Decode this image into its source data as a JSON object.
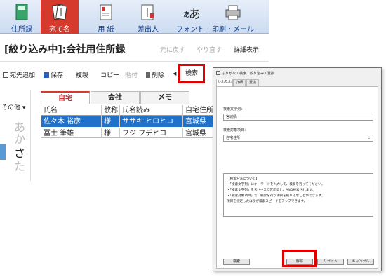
{
  "ribbon": {
    "tabs": [
      {
        "label": "住所録",
        "icon": "address-book-icon"
      },
      {
        "label": "宛て名",
        "icon": "envelope-address-icon",
        "active": true
      },
      {
        "label": "用 紙",
        "icon": "paper-icon"
      },
      {
        "label": "差出人",
        "icon": "sender-icon"
      },
      {
        "label": "フォント",
        "icon": "font-icon"
      },
      {
        "label": "印刷・メール",
        "icon": "printer-mail-icon"
      }
    ],
    "active_color": "#d53a2c",
    "label_color": "#0f3f8c"
  },
  "titlebar": {
    "title": "[絞り込み中]:会社用住所録",
    "undo_label": "元に戻す",
    "redo_label": "やり直す",
    "detail_label": "詳細表示"
  },
  "toolbar": {
    "add_label": "宛先追加",
    "save_label": "保存",
    "duplicate_label": "複製",
    "copy_label": "コピー",
    "paste_label": "貼付",
    "delete_label": "削除",
    "search_label": "検索"
  },
  "left_panel": {
    "group_label": "その他",
    "kana": [
      "あ",
      "か",
      "さ",
      "た"
    ],
    "selected_kana": "さ"
  },
  "grid_tabs": [
    "自宅",
    "会社",
    "メモ"
  ],
  "table": {
    "columns": [
      "氏名",
      "敬称",
      "氏名読み",
      "自宅住所"
    ],
    "rows": [
      {
        "name": "佐々木 裕彦",
        "honorific": "様",
        "reading": "ササキ ヒロヒコ",
        "address": "宮城県"
      },
      {
        "name": "冨士 筆雄",
        "honorific": "様",
        "reading": "フジ フデヒコ",
        "address": "宮城県"
      }
    ],
    "selected_color": "#1f71c9"
  },
  "dialog": {
    "title": "ふりがな・検索・絞り込み・置換",
    "tabs": [
      "かんたん",
      "詳細",
      "置換"
    ],
    "search_text_label": "検索文字列：",
    "search_text_value": "宮城県",
    "search_target_label": "検索対象項目：",
    "search_target_value": "自宅住所",
    "info_lines": [
      "【検索方法について】",
      "・「検索文字列」にキーワードを入力して、検索を行ってください。",
      "・「検索文字列」をスペースで区切ると、AND検索されます。",
      "・「検索対象項目」で、検索を行う項目を絞り込むことができます。",
      "  項目を指定したほうが検索スピードをアップできます。"
    ],
    "buttons": {
      "search": "検索",
      "clear": "解除",
      "reset": "リセット",
      "cancel": "キャンセル"
    }
  },
  "highlight_color": "#e00000"
}
